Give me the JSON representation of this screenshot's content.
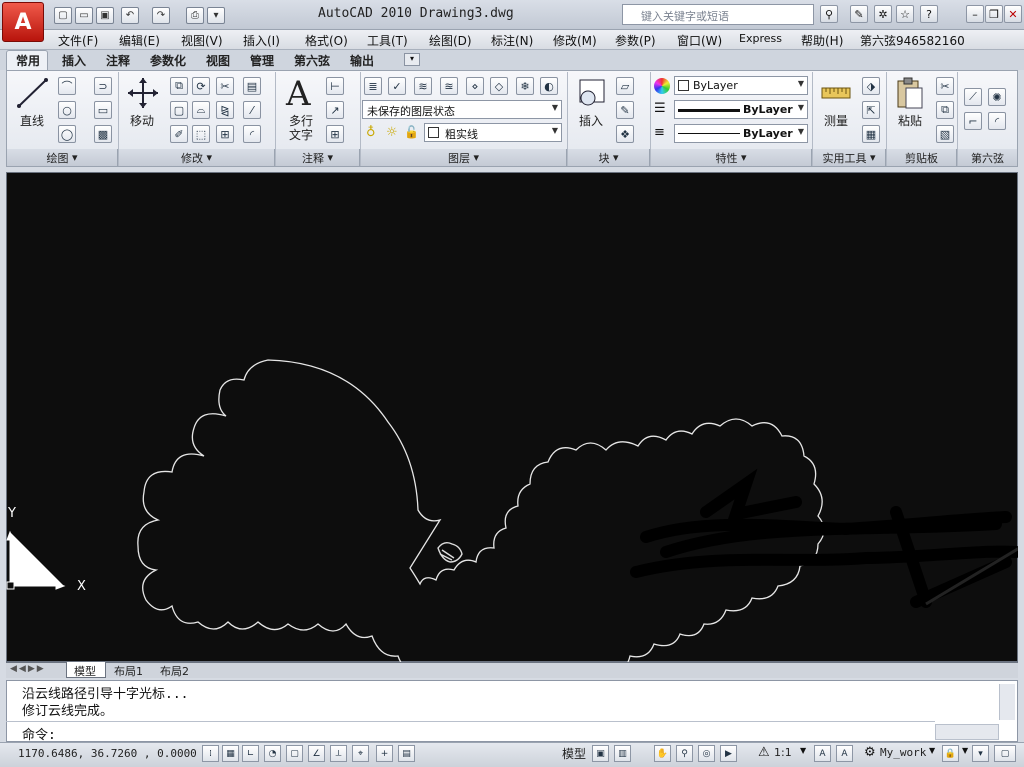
{
  "app": {
    "logo_letter": "A",
    "window_title": "AutoCAD 2010   Drawing3.dwg",
    "search_placeholder": "键入关键字或短语"
  },
  "menus": [
    "文件(F)",
    "编辑(E)",
    "视图(V)",
    "插入(I)",
    "格式(O)",
    "工具(T)",
    "绘图(D)",
    "标注(N)",
    "修改(M)",
    "参数(P)",
    "窗口(W)",
    "Express",
    "帮助(H)",
    "第六弦946582160"
  ],
  "tabs": [
    "常用",
    "插入",
    "注释",
    "参数化",
    "视图",
    "管理",
    "第六弦",
    "输出"
  ],
  "ribbon": {
    "draw": {
      "line_label": "直线",
      "panel": "绘图"
    },
    "modify": {
      "move_label": "移动",
      "panel": "修改"
    },
    "annotate": {
      "mtext_label_1": "多行",
      "mtext_label_2": "文字",
      "panel": "注释"
    },
    "layers": {
      "layer_state": "未保存的图层状态",
      "layer_name": "粗实线",
      "panel": "图层"
    },
    "block": {
      "insert_label": "插入",
      "panel": "块"
    },
    "properties": {
      "color": "ByLayer",
      "linetype": "ByLayer",
      "lineweight": "ByLayer",
      "panel": "特性"
    },
    "utilities": {
      "measure_label": "测量",
      "panel": "实用工具"
    },
    "clipboard": {
      "paste_label": "粘贴",
      "panel": "剪贴板"
    },
    "custom": {
      "panel": "第六弦"
    }
  },
  "canvas": {
    "axis_y": "Y",
    "axis_x": "X"
  },
  "layout_tabs": [
    "模型",
    "布局1",
    "布局2"
  ],
  "command": {
    "line1": "沿云线路径引导十字光标...",
    "line2": "修订云线完成。",
    "prompt": "命令:"
  },
  "status": {
    "coords": "1170.6486, 36.7260 , 0.0000",
    "model": "模型",
    "scale": "1:1",
    "workspace": "My_work"
  },
  "colors": {
    "canvas_bg": "#0d0d0d",
    "accent_red": "#c8180e",
    "ribbon_bg": "#e8ebf0"
  }
}
